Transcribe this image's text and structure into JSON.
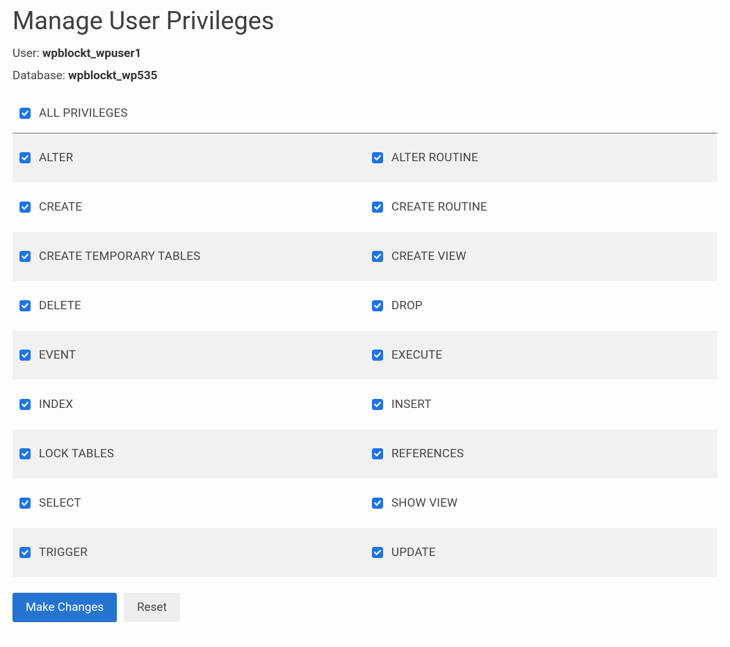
{
  "title": "Manage User Privileges",
  "meta": {
    "user_label": "User: ",
    "user_value": "wpblockt_wpuser1",
    "db_label": "Database: ",
    "db_value": "wpblockt_wp535"
  },
  "all_privileges": {
    "label": "ALL PRIVILEGES",
    "checked": true
  },
  "privileges": [
    {
      "left": {
        "label": "ALTER",
        "checked": true
      },
      "right": {
        "label": "ALTER ROUTINE",
        "checked": true
      }
    },
    {
      "left": {
        "label": "CREATE",
        "checked": true
      },
      "right": {
        "label": "CREATE ROUTINE",
        "checked": true
      }
    },
    {
      "left": {
        "label": "CREATE TEMPORARY TABLES",
        "checked": true
      },
      "right": {
        "label": "CREATE VIEW",
        "checked": true
      }
    },
    {
      "left": {
        "label": "DELETE",
        "checked": true
      },
      "right": {
        "label": "DROP",
        "checked": true
      }
    },
    {
      "left": {
        "label": "EVENT",
        "checked": true
      },
      "right": {
        "label": "EXECUTE",
        "checked": true
      }
    },
    {
      "left": {
        "label": "INDEX",
        "checked": true
      },
      "right": {
        "label": "INSERT",
        "checked": true
      }
    },
    {
      "left": {
        "label": "LOCK TABLES",
        "checked": true
      },
      "right": {
        "label": "REFERENCES",
        "checked": true
      }
    },
    {
      "left": {
        "label": "SELECT",
        "checked": true
      },
      "right": {
        "label": "SHOW VIEW",
        "checked": true
      }
    },
    {
      "left": {
        "label": "TRIGGER",
        "checked": true
      },
      "right": {
        "label": "UPDATE",
        "checked": true
      }
    }
  ],
  "buttons": {
    "make_changes": "Make Changes",
    "reset": "Reset"
  }
}
